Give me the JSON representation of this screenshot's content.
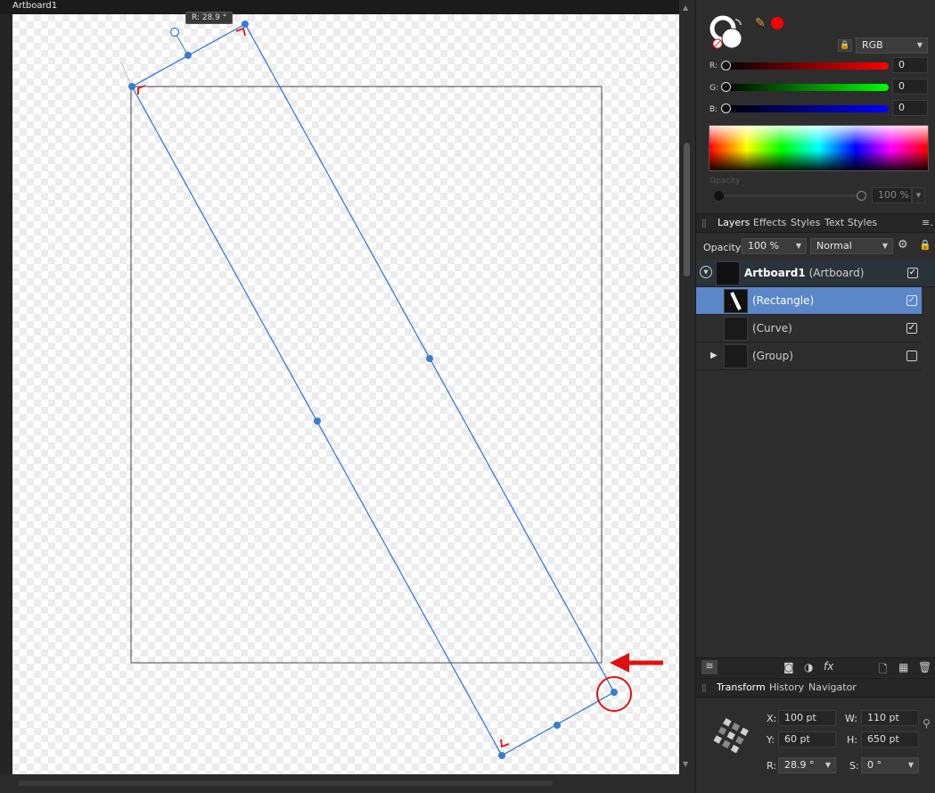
{
  "document": {
    "tab_title": "Artboard1"
  },
  "canvas": {
    "rotation_tooltip": "R: 28.9 °"
  },
  "color": {
    "mode": "RGB",
    "channels": [
      {
        "label": "R:",
        "value": "0"
      },
      {
        "label": "G:",
        "value": "0"
      },
      {
        "label": "B:",
        "value": "0"
      }
    ],
    "opacity_label": "Opacity",
    "opacity_value": "100 %",
    "accent_red": "#ff0000"
  },
  "layers_panel": {
    "tabs": [
      "Layers",
      "Effects",
      "Styles",
      "Text Styles"
    ],
    "opacity_label": "Opacity:",
    "opacity_value": "100 %",
    "blend_mode": "Normal",
    "rows": [
      {
        "name": "Artboard1",
        "type": "(Artboard)",
        "checked": "✓"
      },
      {
        "name": "",
        "type": "(Rectangle)",
        "checked": "✓"
      },
      {
        "name": "",
        "type": "(Curve)",
        "checked": "✓"
      },
      {
        "name": "",
        "type": "(Group)",
        "checked": ""
      }
    ]
  },
  "transform_panel": {
    "tabs": [
      "Transform",
      "History",
      "Navigator"
    ],
    "x_label": "X:",
    "x_value": "100 pt",
    "y_label": "Y:",
    "y_value": "60 pt",
    "w_label": "W:",
    "w_value": "110 pt",
    "h_label": "H:",
    "h_value": "650 pt",
    "r_label": "R:",
    "r_value": "28.9 °",
    "s_label": "S:",
    "s_value": "0 °"
  }
}
